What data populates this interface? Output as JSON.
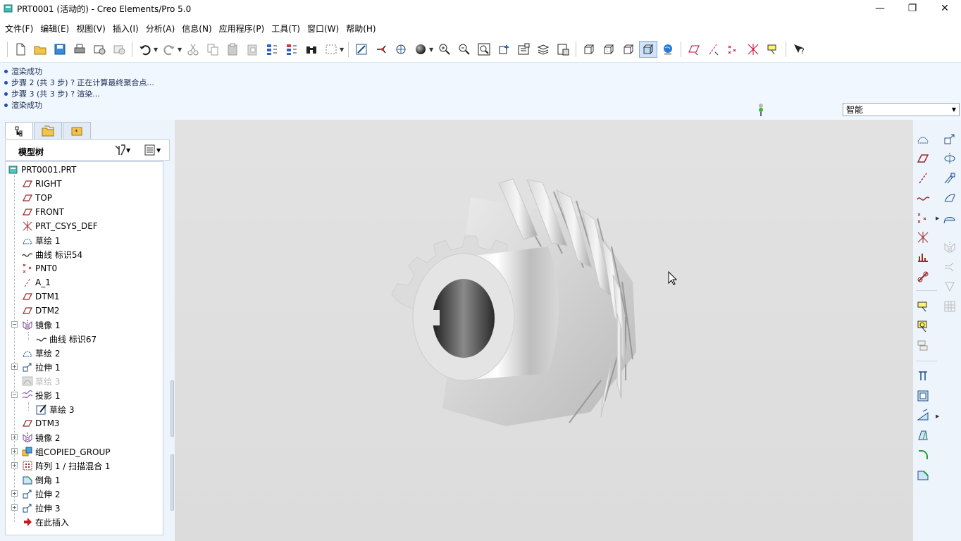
{
  "window": {
    "title": "PRT0001 (活动的) - Creo Elements/Pro 5.0",
    "minimize": "—",
    "maximize": "❐",
    "close": "✕"
  },
  "menu": [
    "文件(F)",
    "编辑(E)",
    "视图(V)",
    "插入(I)",
    "分析(A)",
    "信息(N)",
    "应用程序(P)",
    "工具(T)",
    "窗口(W)",
    "帮助(H)"
  ],
  "messages": [
    "渲染成功",
    "步骤 2 (共 3 步) ? 正在计算最终聚合点...",
    "步骤 3 (共 3 步) ? 渲染...",
    "渲染成功"
  ],
  "filter": {
    "selected": "智能"
  },
  "panel": {
    "tree_title": "模型树",
    "items": [
      {
        "label": "PRT0001.PRT",
        "icon": "part-icon"
      },
      {
        "label": "RIGHT",
        "icon": "datum-plane-icon"
      },
      {
        "label": "TOP",
        "icon": "datum-plane-icon"
      },
      {
        "label": "FRONT",
        "icon": "datum-plane-icon"
      },
      {
        "label": "PRT_CSYS_DEF",
        "icon": "csys-icon"
      },
      {
        "label": "草绘 1",
        "icon": "sketch-icon"
      },
      {
        "label": "曲线 标识54",
        "icon": "curve-icon"
      },
      {
        "label": "PNT0",
        "icon": "datum-point-icon"
      },
      {
        "label": "A_1",
        "icon": "datum-axis-icon"
      },
      {
        "label": "DTM1",
        "icon": "datum-plane-icon"
      },
      {
        "label": "DTM2",
        "icon": "datum-plane-icon"
      },
      {
        "label": "镜像 1",
        "icon": "mirror-icon"
      },
      {
        "label": "曲线 标识67",
        "icon": "curve-icon"
      },
      {
        "label": "草绘 2",
        "icon": "sketch-icon"
      },
      {
        "label": "拉伸 1",
        "icon": "extrude-icon"
      },
      {
        "label": "草绘 3",
        "icon": "sketch-icon"
      },
      {
        "label": "投影 1",
        "icon": "project-icon"
      },
      {
        "label": "草绘 3",
        "icon": "sketch-edit-icon"
      },
      {
        "label": "DTM3",
        "icon": "datum-plane-icon"
      },
      {
        "label": "镜像 2",
        "icon": "mirror-icon"
      },
      {
        "label": "组COPIED_GROUP",
        "icon": "group-icon"
      },
      {
        "label": "阵列 1 / 扫描混合 1",
        "icon": "pattern-icon"
      },
      {
        "label": "倒角 1",
        "icon": "chamfer-icon"
      },
      {
        "label": "拉伸 2",
        "icon": "extrude-icon"
      },
      {
        "label": "拉伸 3",
        "icon": "extrude-icon"
      },
      {
        "label": "在此插入",
        "icon": "insert-here-icon"
      }
    ]
  }
}
